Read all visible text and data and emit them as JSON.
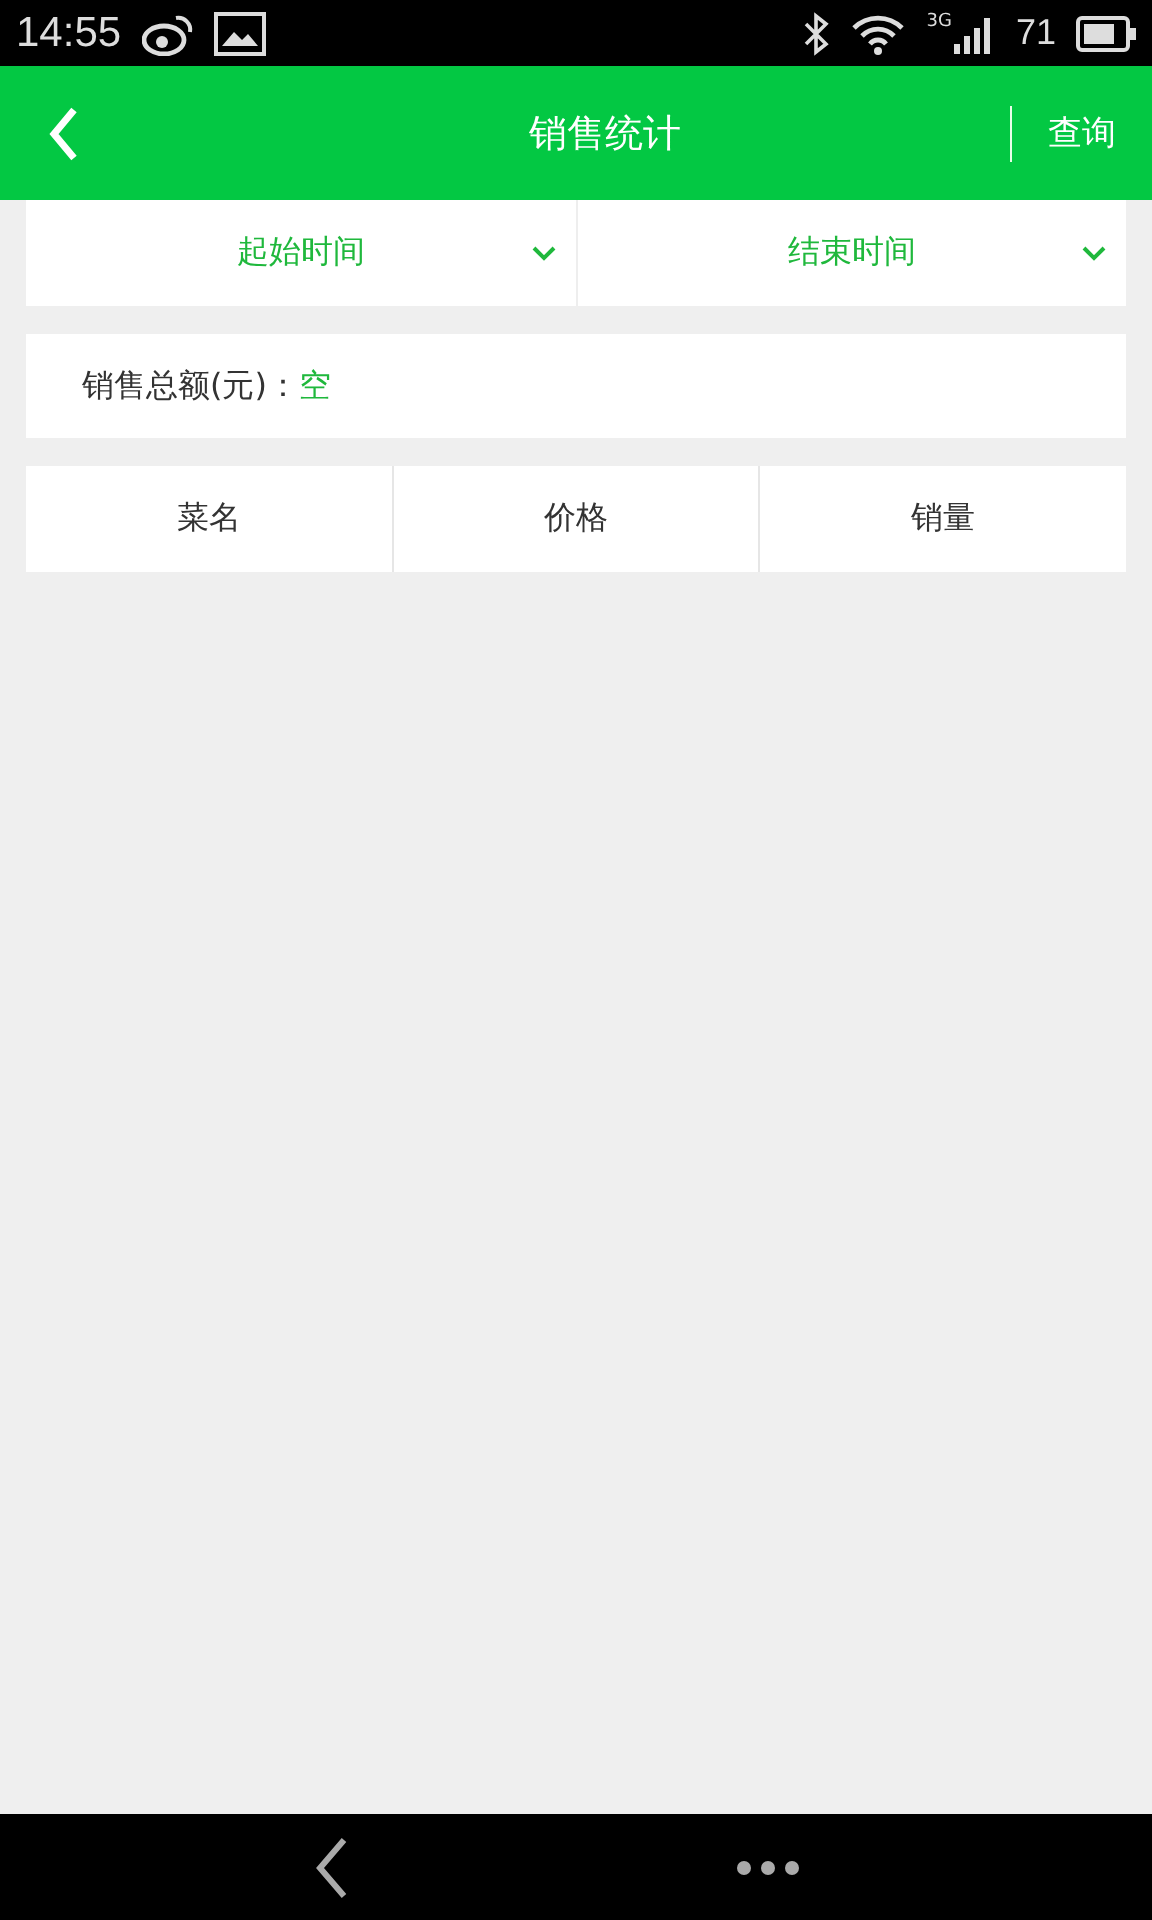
{
  "status_bar": {
    "time": "14:55",
    "network": "3G",
    "battery": "71"
  },
  "header": {
    "title": "销售统计",
    "action": "查询"
  },
  "filters": [
    {
      "label": "起始时间"
    },
    {
      "label": "结束时间"
    }
  ],
  "total": {
    "label": "销售总额(元)：",
    "value": "空"
  },
  "table": {
    "columns": [
      "菜名",
      "价格",
      "销量"
    ]
  }
}
